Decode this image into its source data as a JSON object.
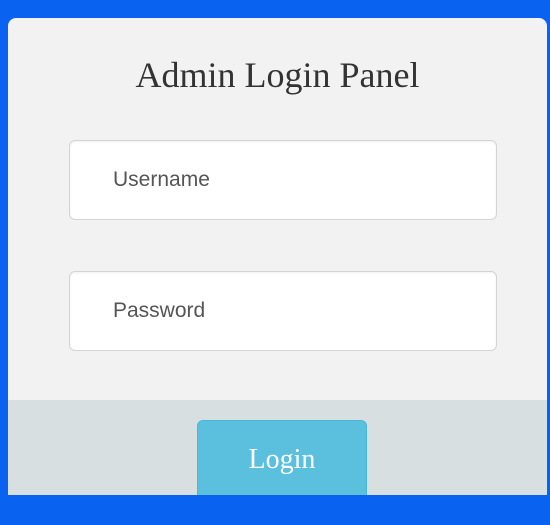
{
  "login_panel": {
    "title": "Admin Login Panel",
    "username": {
      "placeholder": "Username",
      "value": ""
    },
    "password": {
      "placeholder": "Password",
      "value": ""
    },
    "login_label": "Login"
  },
  "colors": {
    "background": "#0a63f0",
    "panel": "#f2f2f2",
    "footer": "#d7dfe0",
    "button": "#5bc0de"
  }
}
